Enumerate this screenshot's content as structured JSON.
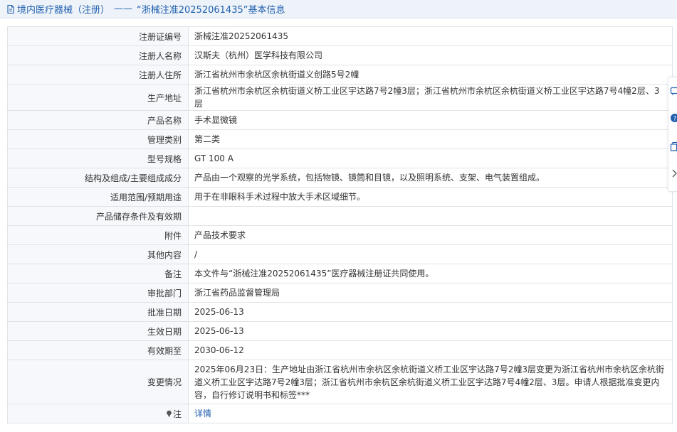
{
  "header": {
    "category": "境内医疗器械（注册）",
    "separator": "——",
    "title": "“浙械注准20252061435”基本信息"
  },
  "rows": [
    {
      "label": "注册证编号",
      "value": "浙械注准20252061435"
    },
    {
      "label": "注册人名称",
      "value": "汉斯夫（杭州）医学科技有限公司"
    },
    {
      "label": "注册人住所",
      "value": "浙江省杭州市余杭区余杭街道义创路5号2幢"
    },
    {
      "label": "生产地址",
      "value": "浙江省杭州市余杭区余杭街道义桥工业区宇达路7号2幢3层；浙江省杭州市余杭区余杭街道义桥工业区宇达路7号4幢2层、3层"
    },
    {
      "label": "产品名称",
      "value": "手术显微镜"
    },
    {
      "label": "管理类别",
      "value": "第二类"
    },
    {
      "label": "型号规格",
      "value": "GT 100 A"
    },
    {
      "label": "结构及组成/主要组成成分",
      "value": "产品由一个观察的光学系统，包括物镜、镜筒和目镜，以及照明系统、支架、电气装置组成。"
    },
    {
      "label": "适用范围/预期用途",
      "value": "用于在非眼科手术过程中放大手术区域细节。"
    },
    {
      "label": "产品储存条件及有效期",
      "value": ""
    },
    {
      "label": "附件",
      "value": "产品技术要求"
    },
    {
      "label": "其他内容",
      "value": "/"
    },
    {
      "label": "备注",
      "value": "本文件与“浙械注准20252061435”医疗器械注册证共同使用。"
    },
    {
      "label": "审批部门",
      "value": "浙江省药品监督管理局"
    },
    {
      "label": "批准日期",
      "value": "2025-06-13"
    },
    {
      "label": "生效日期",
      "value": "2025-06-13"
    },
    {
      "label": "有效期至",
      "value": "2030-06-12"
    },
    {
      "label": "变更情况",
      "value": "2025年06月23日：生产地址由浙江省杭州市余杭区余杭街道义桥工业区宇达路7号2幢3层变更为浙江省杭州市余杭区余杭街道义桥工业区宇达路7号2幢3层；浙江省杭州市余杭区余杭街道义桥工业区宇达路7号4幢2层、3层。申请人根据批准变更内容，自行修订说明书和标签***"
    }
  ],
  "note": {
    "label": "注",
    "link": "详情"
  },
  "colors": {
    "link": "#1f5fae",
    "label_bg": "#f6f8fb",
    "border": "#dfe3e8",
    "header_bg": "#eef3f9"
  },
  "icons": {
    "header": "document-icon",
    "note": "pin-icon",
    "side": [
      "chat-icon",
      "help-icon",
      "copy-icon",
      "chevron-right-icon"
    ]
  }
}
